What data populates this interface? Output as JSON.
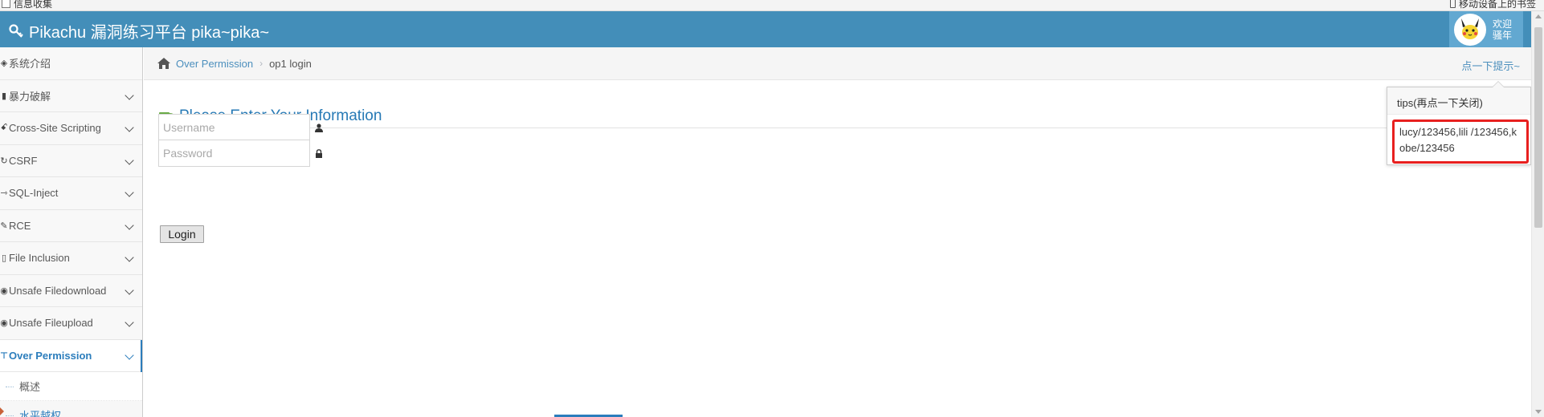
{
  "bookmarks": {
    "left_label": "信息收集",
    "right_label": "移动设备上的书签"
  },
  "navbar": {
    "brand": "Pikachu 漏洞练习平台 pika~pika~",
    "user_line1": "欢迎",
    "user_line2": "骚年"
  },
  "sidebar": {
    "items": [
      {
        "label": "系统介绍",
        "icon": "desktop-icon"
      },
      {
        "label": "暴力破解",
        "icon": "lock-icon"
      },
      {
        "label": "Cross-Site Scripting",
        "icon": "link-icon"
      },
      {
        "label": "CSRF",
        "icon": "refresh-icon"
      },
      {
        "label": "SQL-Inject",
        "icon": "arrow-icon"
      },
      {
        "label": "RCE",
        "icon": "pencil-icon"
      },
      {
        "label": "File Inclusion",
        "icon": "file-icon"
      },
      {
        "label": "Unsafe Filedownload",
        "icon": "download-icon"
      },
      {
        "label": "Unsafe Fileupload",
        "icon": "upload-icon"
      },
      {
        "label": "Over Permission",
        "icon": "key-icon"
      }
    ],
    "submenu": [
      {
        "label": "概述"
      },
      {
        "label": "水平越权"
      }
    ]
  },
  "breadcrumbs": {
    "parent": "Over Permission",
    "current": "op1 login"
  },
  "hint_link": "点一下提示~",
  "tips": {
    "title": "tips(再点一下关闭)",
    "body": "lucy/123456,lili /123456,kobe/123456"
  },
  "form": {
    "title": "Please Enter Your Information",
    "username_placeholder": "Username",
    "password_placeholder": "Password",
    "login_label": "Login"
  },
  "colors": {
    "navbar": "#438eb9",
    "link": "#4c8fbd",
    "highlight": "#e8201f"
  }
}
